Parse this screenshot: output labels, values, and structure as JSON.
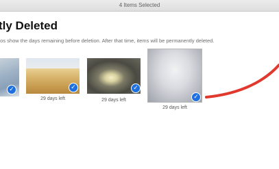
{
  "window": {
    "title": "4 Items Selected"
  },
  "header": {
    "title": "tly Deleted",
    "subtitle": "eos show the days remaining before deletion. After that time, items will be permanently deleted."
  },
  "photos": [
    {
      "caption": "",
      "selected": true,
      "label": "partial-photo"
    },
    {
      "caption": "29 days left",
      "selected": true,
      "label": "wheat-field-photo"
    },
    {
      "caption": "29 days left",
      "selected": true,
      "label": "lotus-flower-photo"
    },
    {
      "caption": "29 days left",
      "selected": true,
      "label": "white-ice-photo"
    }
  ],
  "colors": {
    "accent": "#1e6fe0",
    "annotation": "#e03a2f"
  }
}
